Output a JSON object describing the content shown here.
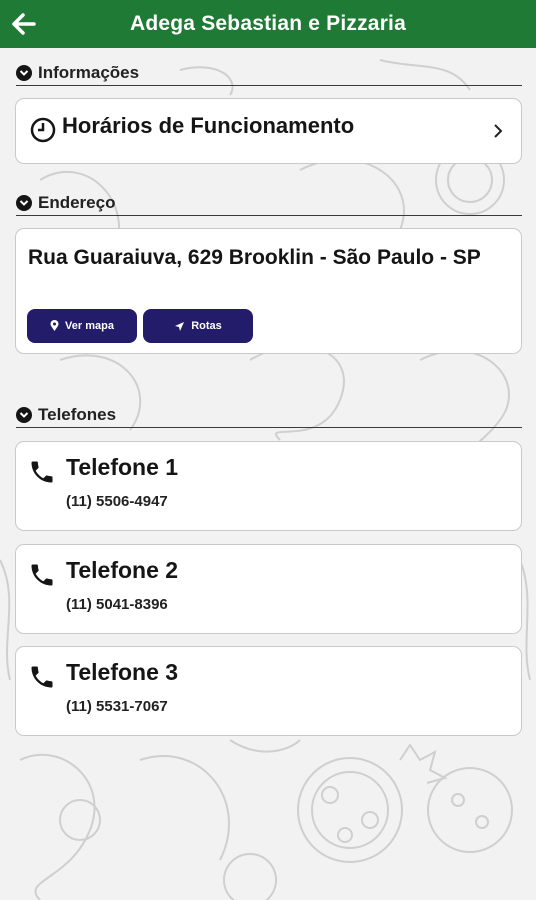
{
  "header": {
    "title": "Adega Sebastian e Pizzaria",
    "back_icon": "arrow-left-icon",
    "color": "#1e7a35"
  },
  "sections": {
    "info": {
      "label": "Informações"
    },
    "address": {
      "label": "Endereço"
    },
    "phones": {
      "label": "Telefones"
    }
  },
  "hours": {
    "label": "Horários de Funcionamento",
    "icon": "clock-icon",
    "chevron_icon": "chevron-right-icon"
  },
  "address": {
    "text": "Rua Guaraiuva, 629 Brooklin - São Paulo - SP",
    "map_button": "Ver mapa",
    "routes_button": "Rotas",
    "button_color": "#221c6a"
  },
  "phones": [
    {
      "label": "Telefone 1",
      "number": "(11) 5506-4947"
    },
    {
      "label": "Telefone 2",
      "number": "(11) 5041-8396"
    },
    {
      "label": "Telefone 3",
      "number": "(11) 5531-7067"
    }
  ]
}
